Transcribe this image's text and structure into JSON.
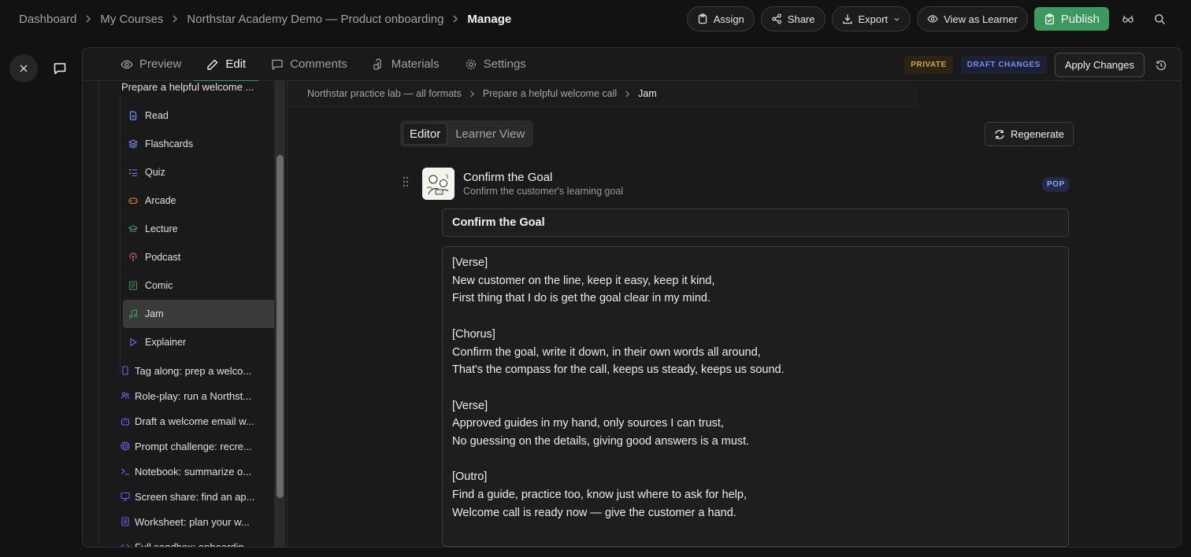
{
  "breadcrumb": {
    "items": [
      "Dashboard",
      "My Courses",
      "Northstar Academy Demo — Product onboarding"
    ],
    "current": "Manage"
  },
  "top_actions": {
    "assign": "Assign",
    "share": "Share",
    "export": "Export",
    "view_as_learner": "View as Learner",
    "publish": "Publish"
  },
  "tabs": [
    {
      "label": "Preview",
      "icon": "eye-icon"
    },
    {
      "label": "Edit",
      "icon": "pencil-icon",
      "active": true
    },
    {
      "label": "Comments",
      "icon": "comment-icon"
    },
    {
      "label": "Materials",
      "icon": "materials-icon"
    },
    {
      "label": "Settings",
      "icon": "gear-icon"
    }
  ],
  "status": {
    "private": "PRIVATE",
    "draft": "DRAFT CHANGES",
    "apply": "Apply Changes"
  },
  "tree": {
    "parent": "Prepare a helpful welcome ...",
    "children": [
      {
        "label": "Read",
        "icon": "document-icon",
        "color": "#6f8ff2"
      },
      {
        "label": "Flashcards",
        "icon": "layers-icon",
        "color": "#6f8ff2"
      },
      {
        "label": "Quiz",
        "icon": "checklist-icon",
        "color": "#6f8ff2"
      },
      {
        "label": "Arcade",
        "icon": "gamepad-icon",
        "color": "#e0863a"
      },
      {
        "label": "Lecture",
        "icon": "graduation-cap-icon",
        "color": "#3a9a5b"
      },
      {
        "label": "Podcast",
        "icon": "podcast-icon",
        "color": "#d65c9a"
      },
      {
        "label": "Comic",
        "icon": "image-icon",
        "color": "#3a9a5b"
      },
      {
        "label": "Jam",
        "icon": "music-note-icon",
        "color": "#3a9a5b",
        "selected": true
      },
      {
        "label": "Explainer",
        "icon": "play-icon",
        "color": "#8a5cf0"
      }
    ],
    "siblings": [
      {
        "label": "Tag along: prep a welco...",
        "icon": "phone-icon",
        "color": "#7a5cf0"
      },
      {
        "label": "Role-play: run a Northst...",
        "icon": "users-icon",
        "color": "#7a5cf0"
      },
      {
        "label": "Draft a welcome email w...",
        "icon": "robot-icon",
        "color": "#7a5cf0"
      },
      {
        "label": "Prompt challenge: recre...",
        "icon": "target-icon",
        "color": "#7a5cf0"
      },
      {
        "label": "Notebook: summarize o...",
        "icon": "terminal-icon",
        "color": "#7a5cf0"
      },
      {
        "label": "Screen share: find an ap...",
        "icon": "monitor-icon",
        "color": "#7a5cf0"
      },
      {
        "label": "Worksheet: plan your w...",
        "icon": "worksheet-icon",
        "color": "#7a5cf0"
      },
      {
        "label": "Full sandbox: onboardin...",
        "icon": "code-icon",
        "color": "#7a5cf0"
      }
    ]
  },
  "content_breadcrumb": {
    "items": [
      "Northstar practice lab — all formats",
      "Prepare a helpful welcome call"
    ],
    "current": "Jam"
  },
  "view_toggle": {
    "editor": "Editor",
    "learner": "Learner View"
  },
  "regenerate": "Regenerate",
  "item": {
    "title": "Confirm the Goal",
    "subtitle": "Confirm the customer's learning goal",
    "badge": "POP"
  },
  "title_field": "Confirm the Goal",
  "lyrics": "[Verse]\nNew customer on the line, keep it easy, keep it kind,\nFirst thing that I do is get the goal clear in my mind.\n\n[Chorus]\nConfirm the goal, write it down, in their own words all around,\nThat's the compass for the call, keeps us steady, keeps us sound.\n\n[Verse]\nApproved guides in my hand, only sources I can trust,\nNo guessing on the details, giving good answers is a must.\n\n[Outro]\nFind a guide, practice too, know just where to ask for help,\nWelcome call is ready now — give the customer a hand.",
  "colors": {
    "accent": "#3a9a5b",
    "private": "#d6a23a",
    "draft": "#6f8ff2"
  }
}
